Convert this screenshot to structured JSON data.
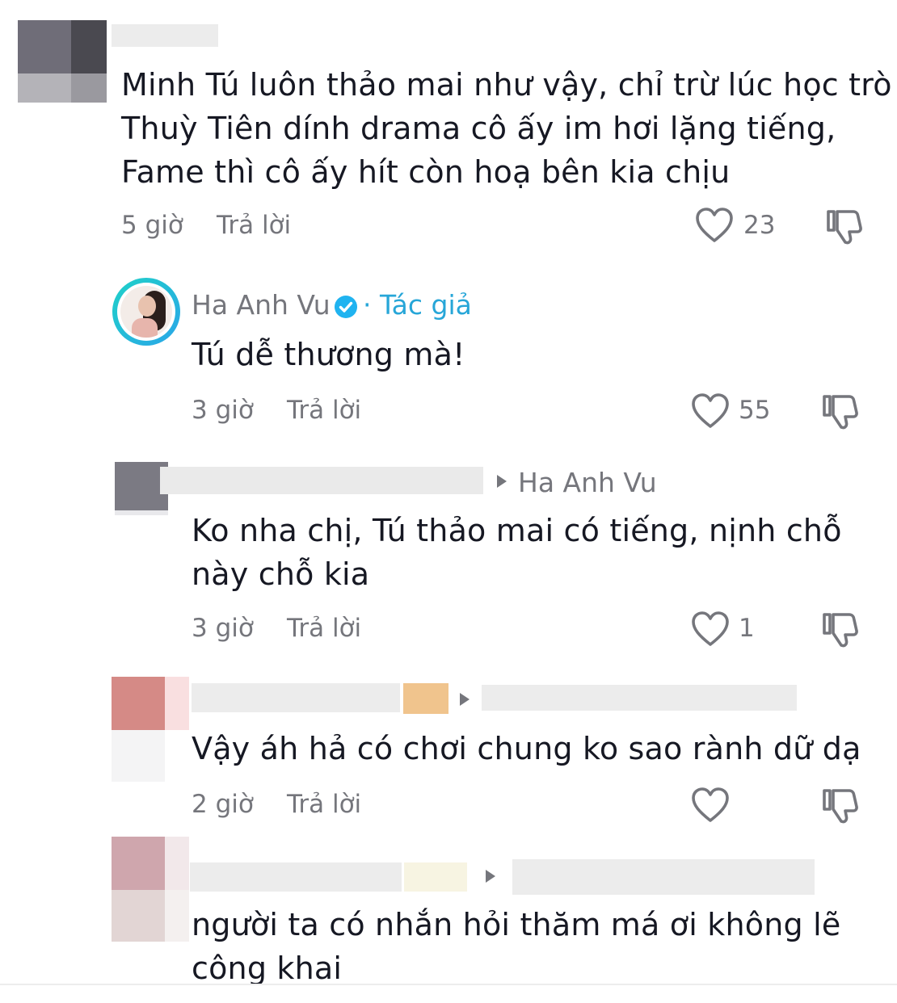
{
  "comments": [
    {
      "text_lines": [
        "Minh Tú luôn thảo mai như vậy, chỉ trừ lúc học trò",
        "Thuỳ Tiên dính drama cô ấy im hơi lặng tiếng,",
        "Fame thì cô ấy hít còn hoạ bên kia chịu"
      ],
      "time": "5 giờ",
      "reply_label": "Trả lời",
      "likes": "23"
    },
    {
      "author": "Ha Anh Vu",
      "author_badge": "· Tác giả",
      "text_lines": [
        "Tú dễ thương mà!"
      ],
      "time": "3 giờ",
      "reply_label": "Trả lời",
      "likes": "55"
    },
    {
      "reply_to": "Ha Anh Vu",
      "text_lines": [
        "Ko nha chị, Tú thảo mai có tiếng, nịnh chỗ",
        "này chỗ kia"
      ],
      "time": "3 giờ",
      "reply_label": "Trả lời",
      "likes": "1"
    },
    {
      "text_lines": [
        "Vậy áh hả có chơi chung ko sao rành dữ dạ"
      ],
      "time": "2 giờ",
      "reply_label": "Trả lời",
      "likes": ""
    },
    {
      "text_lines": [
        "người ta có nhắn hỏi thăm má ơi không lẽ",
        "công khai"
      ]
    }
  ],
  "icons": {
    "like": "heart-outline-icon",
    "dislike": "thumbs-down-outline-icon",
    "verified": "verified-badge-icon",
    "reply_arrow": "play-triangle-icon"
  },
  "colors": {
    "text": "#161823",
    "meta": "#75767c",
    "author_badge": "#27a6d8",
    "verified": "#20b3f0"
  }
}
